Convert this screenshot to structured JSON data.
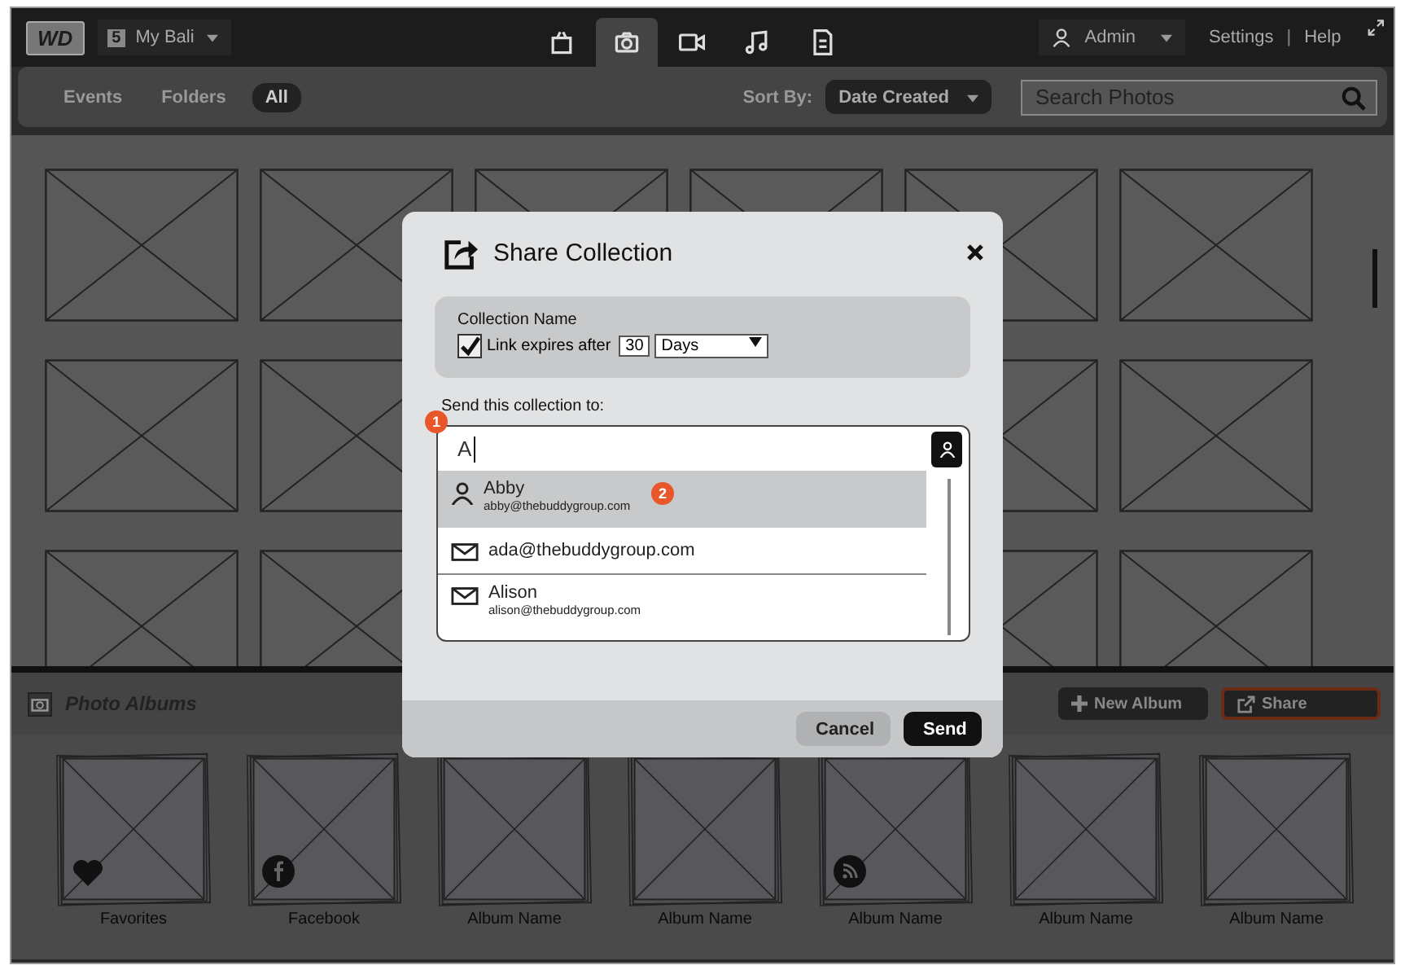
{
  "top_bar": {
    "logo": "WD",
    "device_number": "5",
    "device_name": "My Bali",
    "media_tabs": [
      {
        "kind": "bag",
        "selected": false
      },
      {
        "kind": "camera",
        "selected": true
      },
      {
        "kind": "video",
        "selected": false
      },
      {
        "kind": "music",
        "selected": false
      },
      {
        "kind": "document",
        "selected": false
      }
    ],
    "user": "Admin",
    "links": [
      "Settings",
      "|",
      "Help"
    ]
  },
  "toolbar": {
    "filters": [
      {
        "label": "Events",
        "selected": false
      },
      {
        "label": "Folders",
        "selected": false
      },
      {
        "label": "All",
        "selected": true
      }
    ],
    "sort_label": "Sort By:",
    "sort_value": "Date Created",
    "search": {
      "placeholder": "Search Photos"
    }
  },
  "albums_bar": {
    "title": "Photo Albums",
    "buttons": [
      {
        "label": "New Album",
        "kind": "new"
      },
      {
        "label": "Share",
        "kind": "share"
      }
    ]
  },
  "albums": [
    {
      "name": "Favorites",
      "kind": "heart"
    },
    {
      "name": "Facebook",
      "kind": "facebook"
    },
    {
      "name": "Album Name",
      "kind": "plain"
    },
    {
      "name": "Album Name",
      "kind": "plain"
    },
    {
      "name": "Album Name",
      "kind": "rss"
    },
    {
      "name": "Album Name",
      "kind": "plain"
    },
    {
      "name": "Album Name",
      "kind": "plain"
    }
  ],
  "dialog": {
    "title": "Share Collection",
    "collection_label": "Collection Name",
    "expires": {
      "checked": true,
      "label": "Link expires after",
      "value": "30",
      "unit": "Days"
    },
    "send_label": "Send this collection to:",
    "recipient": {
      "value": "A"
    },
    "suggestions": [
      {
        "kind": "contact",
        "name": "Abby",
        "email": "abby@thebuddygroup.com",
        "selected": true
      },
      {
        "kind": "email",
        "name": "ada@thebuddygroup.com",
        "selected": false
      },
      {
        "kind": "email",
        "name": "Alison",
        "email": "alison@thebuddygroup.com",
        "selected": false
      }
    ],
    "markers": [
      "1",
      "2"
    ],
    "buttons": [
      {
        "label": "Cancel",
        "kind": "secondary"
      },
      {
        "label": "Send",
        "kind": "primary"
      }
    ]
  }
}
